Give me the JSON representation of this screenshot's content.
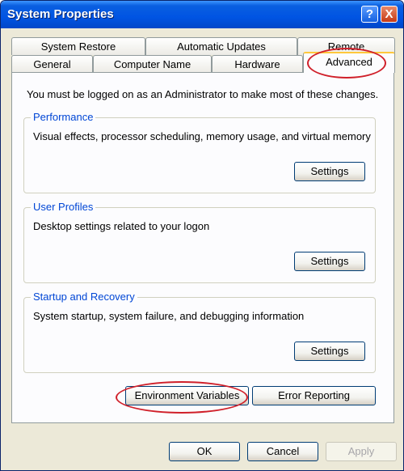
{
  "window": {
    "title": "System Properties"
  },
  "title_buttons": {
    "help": "?",
    "close": "X"
  },
  "tabs_back": [
    "System Restore",
    "Automatic Updates",
    "Remote"
  ],
  "tabs_front": [
    "General",
    "Computer Name",
    "Hardware",
    "Advanced"
  ],
  "active_tab": "Advanced",
  "panel": {
    "admin_note": "You must be logged on as an Administrator to make most of these changes.",
    "groups": [
      {
        "title": "Performance",
        "description": "Visual effects, processor scheduling, memory usage, and virtual memory",
        "button": "Settings"
      },
      {
        "title": "User Profiles",
        "description": "Desktop settings related to your logon",
        "button": "Settings"
      },
      {
        "title": "Startup and Recovery",
        "description": "System startup, system failure, and debugging information",
        "button": "Settings"
      }
    ],
    "env_button": "Environment Variables",
    "error_button": "Error Reporting"
  },
  "footer": {
    "ok": "OK",
    "cancel": "Cancel",
    "apply": "Apply"
  },
  "highlight_color": "#d0202a"
}
